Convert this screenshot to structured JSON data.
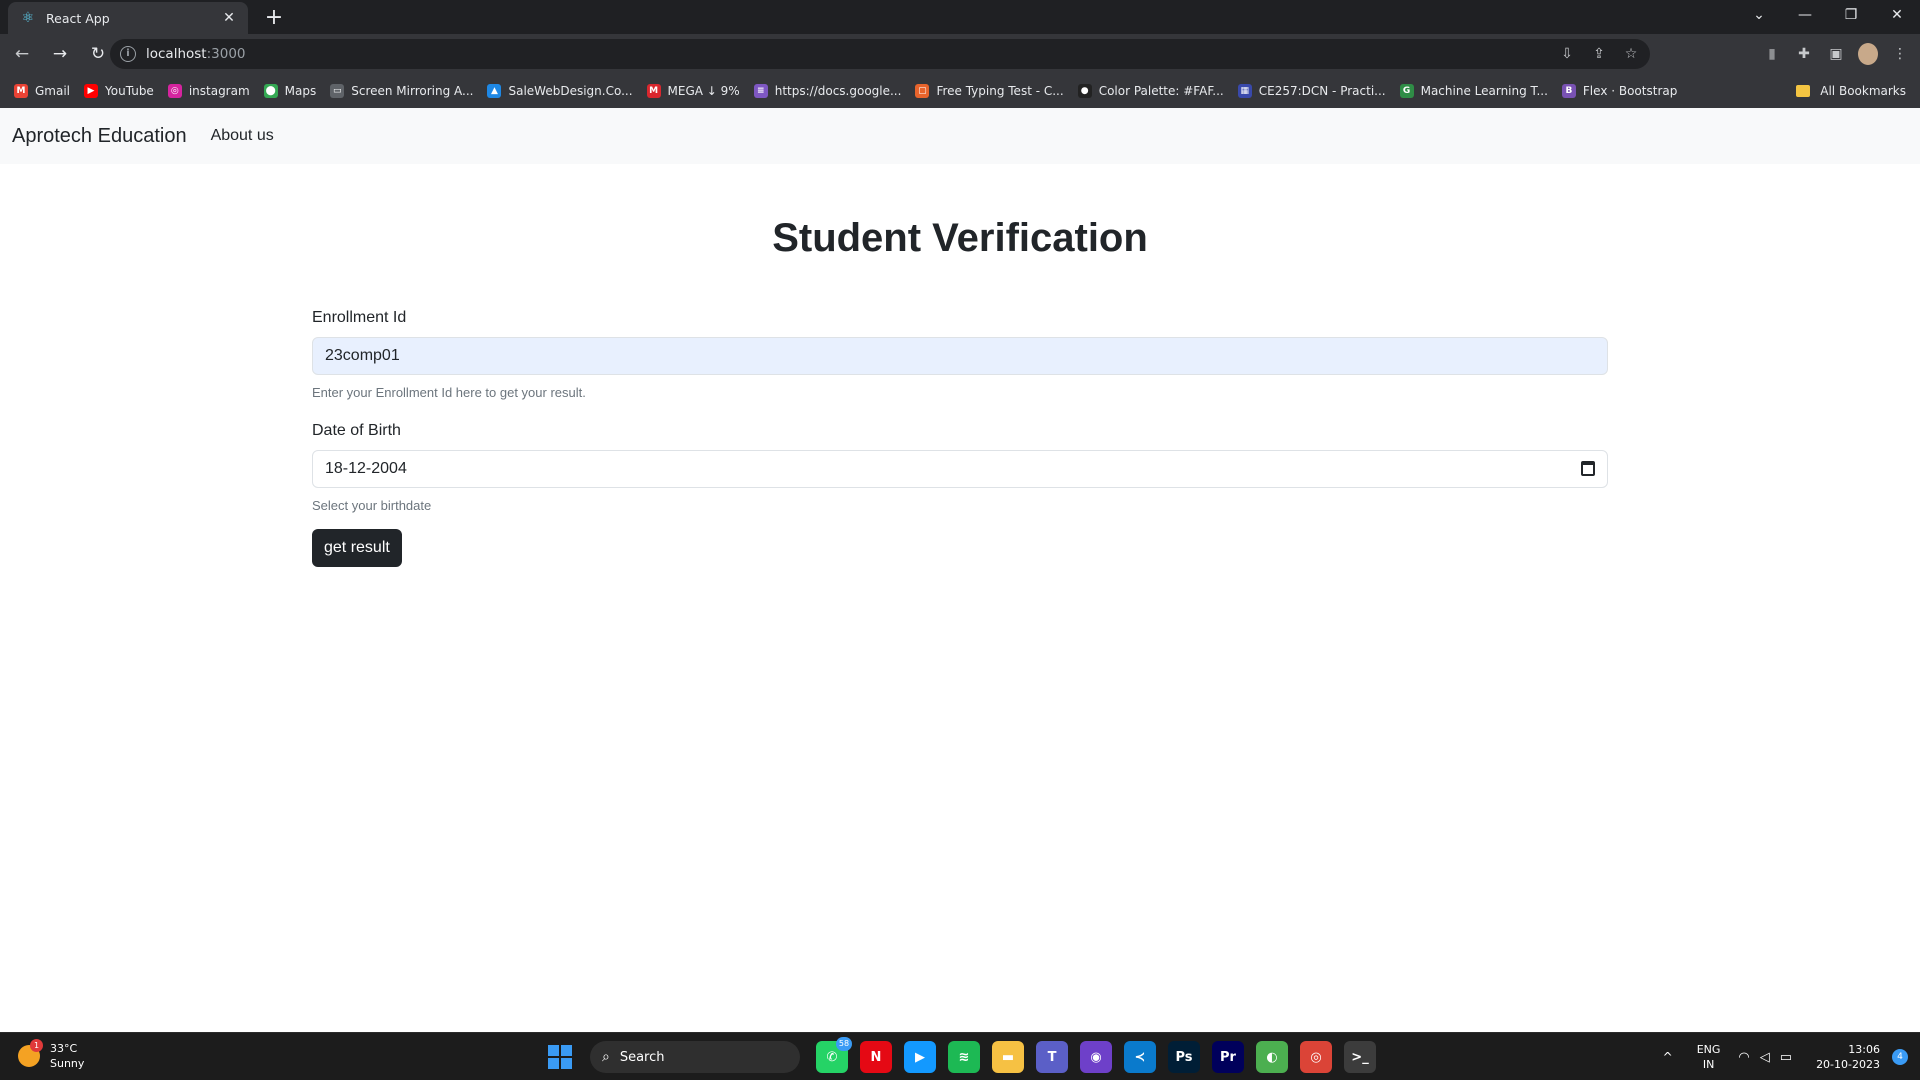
{
  "browser": {
    "tab": {
      "title": "React App",
      "favicon": "react-icon",
      "close": "✕"
    },
    "new_tab": "+",
    "window_controls": [
      "⌄",
      "—",
      "❐",
      "✕"
    ],
    "url": {
      "host": "localhost",
      "port": ":3000"
    },
    "bookmarks": [
      {
        "label": "Gmail",
        "icon": "M",
        "color": "#ea4335"
      },
      {
        "label": "YouTube",
        "icon": "▶",
        "color": "#ff0000"
      },
      {
        "label": "instagram",
        "icon": "◎",
        "color": "#d6249f"
      },
      {
        "label": "Maps",
        "icon": "⬤",
        "color": "#34a853"
      },
      {
        "label": "Screen Mirroring A...",
        "icon": "▭",
        "color": "#5f6368"
      },
      {
        "label": "SaleWebDesign.Co...",
        "icon": "▲",
        "color": "#1e88e5"
      },
      {
        "label": "MEGA ↓ 9%",
        "icon": "M",
        "color": "#d9272e"
      },
      {
        "label": "https://docs.google...",
        "icon": "≡",
        "color": "#7e57c2"
      },
      {
        "label": "Free Typing Test - C...",
        "icon": "▢",
        "color": "#e8642c"
      },
      {
        "label": "Color Palette: #FAF...",
        "icon": "●",
        "color": "#222222"
      },
      {
        "label": "CE257:DCN - Practi...",
        "icon": "▦",
        "color": "#3949ab"
      },
      {
        "label": "Machine Learning T...",
        "icon": "G",
        "color": "#2f8d46"
      },
      {
        "label": "Flex · Bootstrap",
        "icon": "B",
        "color": "#7952b3"
      }
    ],
    "all_bookmarks": "All Bookmarks"
  },
  "navbar": {
    "brand": "Aprotech Education",
    "link": "About us"
  },
  "form": {
    "title": "Student Verification",
    "enrollment": {
      "label": "Enrollment Id",
      "value": "23comp01",
      "help": "Enter your Enrollment Id here to get your result."
    },
    "dob": {
      "label": "Date of Birth",
      "value": "18-12-2004",
      "help": "Select your birthdate"
    },
    "submit": "get result"
  },
  "taskbar": {
    "weather": {
      "temp": "33°C",
      "condition": "Sunny",
      "badge": "1"
    },
    "search": "Search",
    "apps": [
      {
        "name": "whatsapp-icon",
        "glyph": "✆",
        "color": "#25d366",
        "badge": "58"
      },
      {
        "name": "netflix-icon",
        "glyph": "N",
        "color": "#e50914"
      },
      {
        "name": "prime-video-icon",
        "glyph": "▶",
        "color": "#1399ff"
      },
      {
        "name": "spotify-icon",
        "glyph": "≋",
        "color": "#1db954"
      },
      {
        "name": "file-explorer-icon",
        "glyph": "▬",
        "color": "#f6c143"
      },
      {
        "name": "teams-icon",
        "glyph": "T",
        "color": "#5b5fc7"
      },
      {
        "name": "github-desktop-icon",
        "glyph": "◉",
        "color": "#6e40c9"
      },
      {
        "name": "vscode-icon",
        "glyph": "≺",
        "color": "#0a7acc"
      },
      {
        "name": "photoshop-icon",
        "glyph": "Ps",
        "color": "#001e36"
      },
      {
        "name": "premiere-icon",
        "glyph": "Pr",
        "color": "#00005b"
      },
      {
        "name": "browser-icon",
        "glyph": "◐",
        "color": "#4caf50"
      },
      {
        "name": "chrome-icon",
        "glyph": "◎",
        "color": "#db4437"
      },
      {
        "name": "terminal-icon",
        "glyph": ">_",
        "color": "#3c3c3c"
      }
    ],
    "tray": {
      "chevron": "^",
      "lang_top": "ENG",
      "lang_bottom": "IN",
      "time": "13:06",
      "date": "20-10-2023",
      "notifications": "4"
    }
  }
}
